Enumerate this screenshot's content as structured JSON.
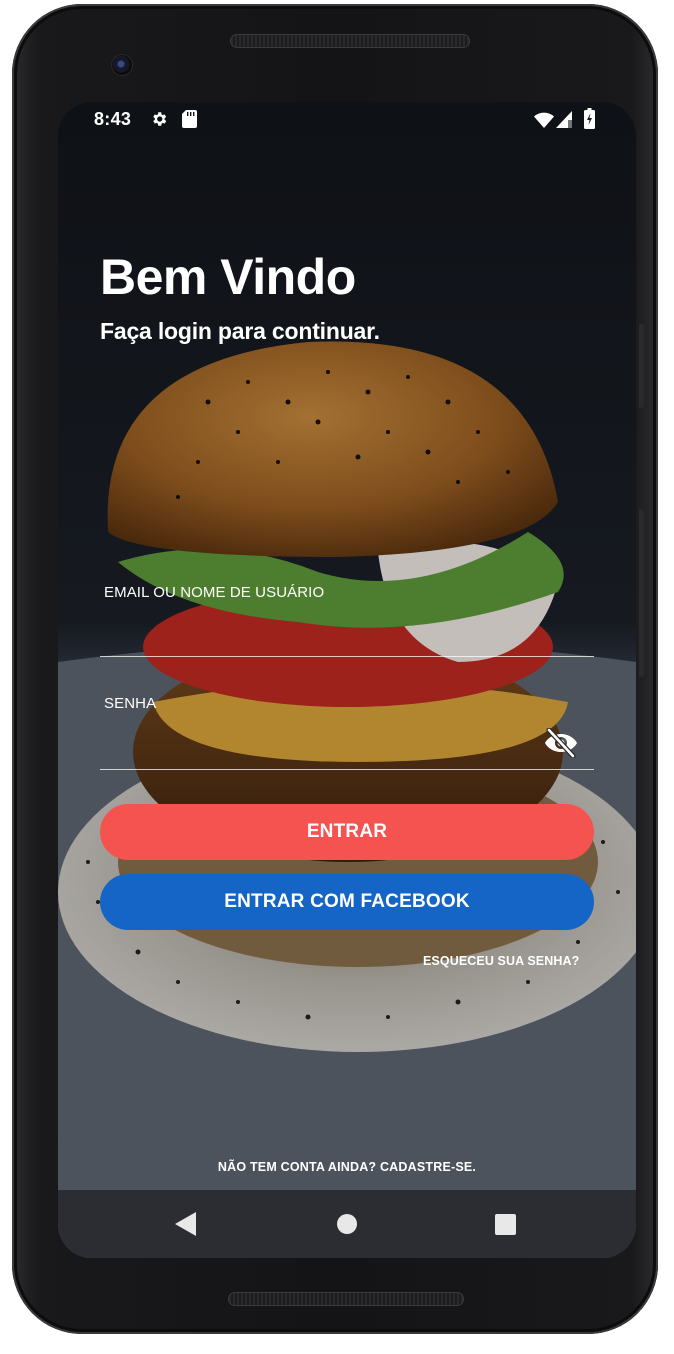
{
  "status_bar": {
    "time": "8:43",
    "icons": [
      "gear-icon",
      "sd-card-icon",
      "wifi-icon",
      "signal-icon",
      "battery-charging-icon"
    ]
  },
  "header": {
    "title": "Bem Vindo",
    "subtitle": "Faça login para continuar."
  },
  "form": {
    "email_label": "EMAIL OU NOME DE USUÁRIO",
    "email_value": "",
    "password_label": "SENHA",
    "password_value": "",
    "password_toggle_icon": "eye-off-icon"
  },
  "actions": {
    "login_label": "ENTRAR",
    "facebook_label": "ENTRAR COM FACEBOOK",
    "forgot_label": "ESQUECEU SUA SENHA?",
    "signup_label": "NÃO TEM CONTA AINDA? CADASTRE-SE."
  },
  "colors": {
    "login_button": "#f5534f",
    "facebook_button": "#1565c6",
    "text": "#ffffff"
  },
  "navigation_bar": {
    "icons": [
      "back-triangle-icon",
      "home-circle-icon",
      "recents-square-icon"
    ]
  }
}
